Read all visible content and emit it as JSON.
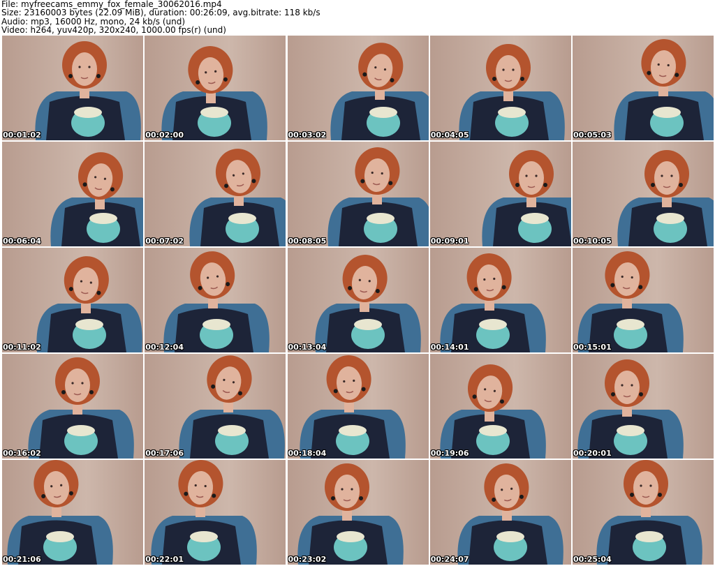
{
  "header": {
    "file_line": "File: myfreecams_emmy_fox_female_30062016.mp4",
    "size_line": "Size: 23160003 bytes (22.09 MiB), duration: 00:26:09, avg.bitrate: 118 kb/s",
    "audio_line": "Audio: mp3, 16000 Hz, mono, 24 kb/s (und)",
    "video_line": "Video: h264, yuv420p, 320x240, 1000.00 fps(r) (und)"
  },
  "thumbnails": [
    {
      "time": "00:01:02"
    },
    {
      "time": "00:02:00"
    },
    {
      "time": "00:03:02"
    },
    {
      "time": "00:04:05"
    },
    {
      "time": "00:05:03"
    },
    {
      "time": "00:06:04"
    },
    {
      "time": "00:07:02"
    },
    {
      "time": "00:08:05"
    },
    {
      "time": "00:09:01"
    },
    {
      "time": "00:10:05"
    },
    {
      "time": "00:11:02"
    },
    {
      "time": "00:12:04"
    },
    {
      "time": "00:13:04"
    },
    {
      "time": "00:14:01"
    },
    {
      "time": "00:15:01"
    },
    {
      "time": "00:16:02"
    },
    {
      "time": "00:17:06"
    },
    {
      "time": "00:18:04"
    },
    {
      "time": "00:19:06"
    },
    {
      "time": "00:20:01"
    },
    {
      "time": "00:21:06"
    },
    {
      "time": "00:22:01"
    },
    {
      "time": "00:23:02"
    },
    {
      "time": "00:24:07"
    },
    {
      "time": "00:25:04"
    }
  ],
  "colors": {
    "wall": "#b89c8f",
    "wall_light": "#cdb7ab",
    "hair": "#b4542e",
    "skin": "#e0b39d",
    "shirt": "#1d2438",
    "chair": "#3f6f95",
    "print": "#6cc3c0",
    "timestamp": "#ffffff"
  }
}
